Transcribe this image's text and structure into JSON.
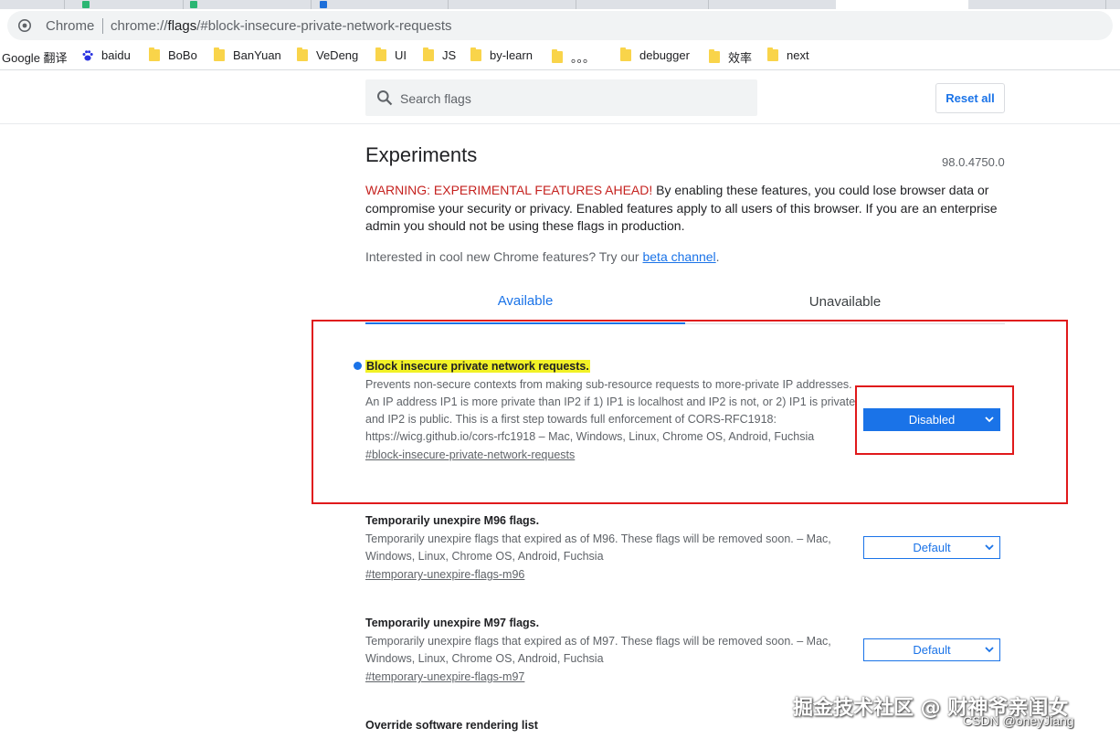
{
  "browser": {
    "omnibox_label": "Chrome",
    "url_scheme": "chrome://",
    "url_host": "flags",
    "url_rest": "/#block-insecure-private-network-requests"
  },
  "bookmarks": [
    {
      "label": "Google 翻译",
      "icon": "none"
    },
    {
      "label": "baidu",
      "icon": "baidu-paw-icon"
    },
    {
      "label": "BoBo",
      "icon": "folder-icon"
    },
    {
      "label": "BanYuan",
      "icon": "folder-icon"
    },
    {
      "label": "VeDeng",
      "icon": "folder-icon"
    },
    {
      "label": "UI",
      "icon": "folder-icon"
    },
    {
      "label": "JS",
      "icon": "folder-icon"
    },
    {
      "label": "by-learn",
      "icon": "folder-icon"
    },
    {
      "label": "。。。",
      "icon": "folder-icon"
    },
    {
      "label": "debugger",
      "icon": "folder-icon"
    },
    {
      "label": "效率",
      "icon": "folder-icon"
    },
    {
      "label": "next",
      "icon": "folder-icon"
    }
  ],
  "header": {
    "search_placeholder": "Search flags",
    "reset_label": "Reset all"
  },
  "main": {
    "title": "Experiments",
    "version": "98.0.4750.0",
    "warning_red": "WARNING: EXPERIMENTAL FEATURES AHEAD!",
    "warning_text": " By enabling these features, you could lose browser data or compromise your security or privacy. Enabled features apply to all users of this browser. If you are an enterprise admin you should not be using these flags in production.",
    "interest_prefix": "Interested in cool new Chrome features? Try our ",
    "interest_link": "beta channel",
    "interest_suffix": ".",
    "tabs": [
      {
        "label": "Available",
        "active": true
      },
      {
        "label": "Unavailable",
        "active": false
      }
    ]
  },
  "experiments": [
    {
      "title": "Block insecure private network requests.",
      "description": "Prevents non-secure contexts from making sub-resource requests to more-private IP addresses. An IP address IP1 is more private than IP2 if 1) IP1 is localhost and IP2 is not, or 2) IP1 is private and IP2 is public. This is a first step towards full enforcement of CORS-RFC1918: https://wicg.github.io/cors-rfc1918 – Mac, Windows, Linux, Chrome OS, Android, Fuchsia",
      "link": "#block-insecure-private-network-requests",
      "value": "Disabled"
    },
    {
      "title": "Temporarily unexpire M96 flags.",
      "description": "Temporarily unexpire flags that expired as of M96. These flags will be removed soon. – Mac, Windows, Linux, Chrome OS, Android, Fuchsia",
      "link": "#temporary-unexpire-flags-m96",
      "value": "Default"
    },
    {
      "title": "Temporarily unexpire M97 flags.",
      "description": "Temporarily unexpire flags that expired as of M97. These flags will be removed soon. – Mac, Windows, Linux, Chrome OS, Android, Fuchsia",
      "link": "#temporary-unexpire-flags-m97",
      "value": "Default"
    },
    {
      "title": "Override software rendering list"
    }
  ],
  "watermark": {
    "line1": "掘金技术社区 @ 财神爷亲闺女",
    "line2": "CSDN @oneyJiang"
  },
  "colors": {
    "accent": "#1a73e8",
    "warning": "#c5221f",
    "highlight": "#f2f226",
    "annotation": "#e0191b"
  }
}
